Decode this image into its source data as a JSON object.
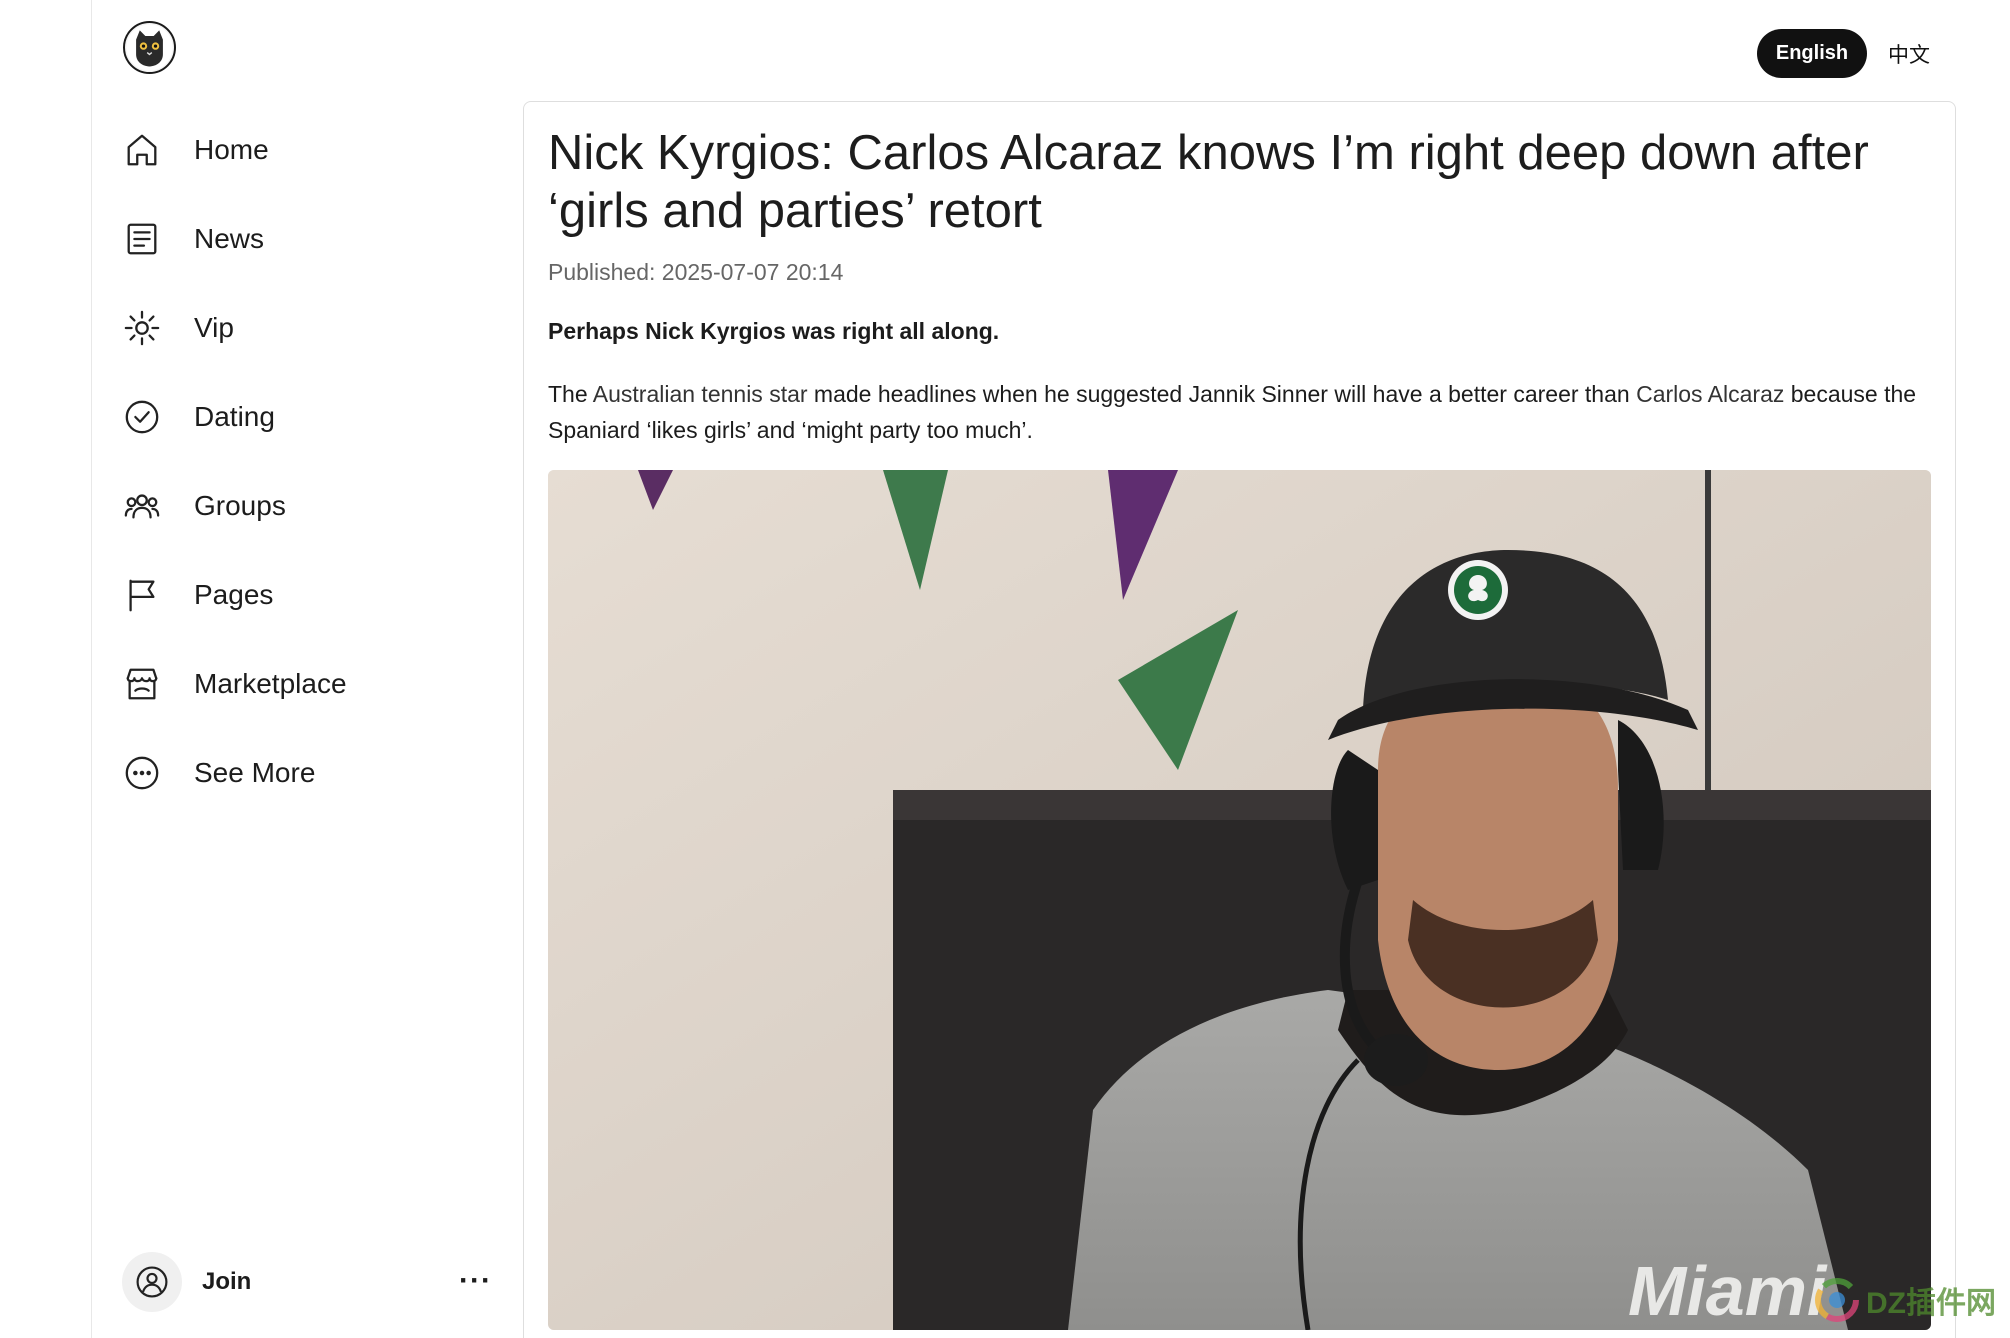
{
  "nav": {
    "items": [
      {
        "label": "Home",
        "icon": "home-icon"
      },
      {
        "label": "News",
        "icon": "news-icon"
      },
      {
        "label": "Vip",
        "icon": "sun-icon"
      },
      {
        "label": "Dating",
        "icon": "check-circle-icon"
      },
      {
        "label": "Groups",
        "icon": "users-icon"
      },
      {
        "label": "Pages",
        "icon": "flag-icon"
      },
      {
        "label": "Marketplace",
        "icon": "store-icon"
      },
      {
        "label": "See More",
        "icon": "more-circle-icon"
      }
    ]
  },
  "footer": {
    "join_label": "Join",
    "more_label": "···"
  },
  "language": {
    "english": "English",
    "chinese": "中文"
  },
  "article": {
    "title": "Nick Kyrgios: Carlos Alcaraz knows I’m right deep down after ‘girls and parties’ retort",
    "published": "Published: 2025-07-07 20:14",
    "lead": "Perhaps Nick Kyrgios was right all along.",
    "body_1": "The ",
    "link_1": "Australian tennis star",
    "body_2": " made headlines when he suggested Jannik Sinner will have a better career than ",
    "link_2": "Carlos Alcaraz",
    "body_3": " because the Spaniard ‘likes girls’ and ‘might party too much’.",
    "hero_sweatshirt_text": "Miami"
  },
  "watermark": {
    "text": "DZ插件网"
  },
  "colors": {
    "accent": "#111111",
    "border": "#dedede",
    "muted_text": "#666666"
  }
}
